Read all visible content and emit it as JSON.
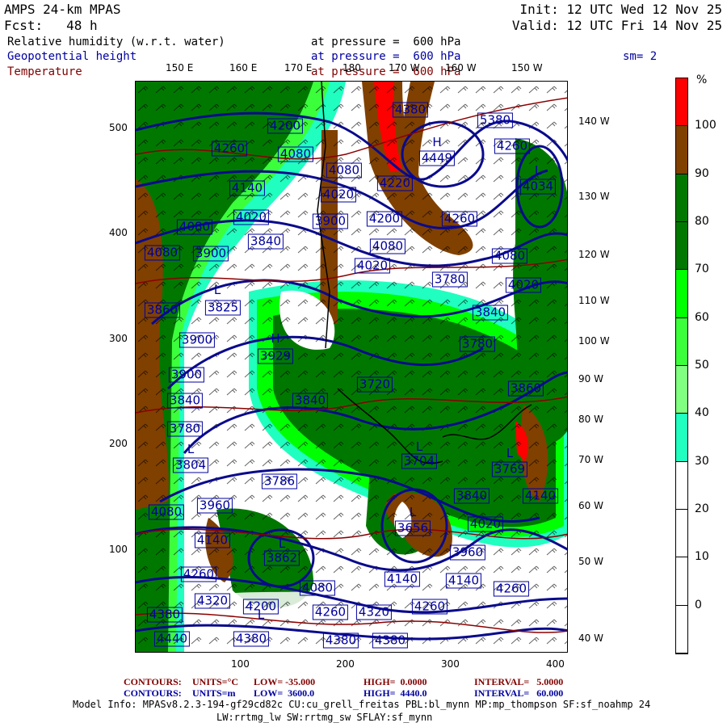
{
  "header": {
    "title": "AMPS 24-km MPAS",
    "forecast": "Fcst:   48 h",
    "init": "Init: 12 UTC Wed 12 Nov 25",
    "valid": "Valid: 12 UTC Fri 14 Nov 25",
    "fields": [
      {
        "name": "Relative humidity (w.r.t. water)",
        "level": "at pressure =  600 hPa"
      },
      {
        "name": "Geopotential height",
        "level": "at pressure =  600 hPa"
      },
      {
        "name": "Temperature",
        "level": "at pressure =  600 hPa"
      }
    ],
    "smoothing": "sm= 2"
  },
  "axes": {
    "top_lon": [
      "150 E",
      "160 E",
      "170 E",
      "180",
      "170 W",
      "160 W",
      "150 W"
    ],
    "right_lon": [
      "140 W",
      "130 W",
      "120 W",
      "110 W",
      "100 W",
      "90 W",
      "80 W",
      "70 W",
      "60 W",
      "50 W",
      "40 W"
    ],
    "left_ticks": [
      "500",
      "400",
      "300",
      "200",
      "100"
    ],
    "bottom_ticks": [
      "100",
      "200",
      "300",
      "400"
    ]
  },
  "colorbar": {
    "unit": "%",
    "labels": [
      "100",
      "90",
      "80",
      "70",
      "60",
      "50",
      "40",
      "30",
      "20",
      "10",
      "0"
    ],
    "colors": [
      "#ff0000",
      "#804000",
      "#007800",
      "#007800",
      "#00ff00",
      "#3cff3c",
      "#80ff80",
      "#20ffc0",
      "#ffffff",
      "#ffffff",
      "#ffffff",
      "#ffffff"
    ]
  },
  "contour_info": {
    "temperature": {
      "label": "CONTOURS:",
      "units": "UNITS=°C",
      "low": "LOW= -35.000",
      "high": "HIGH=  0.0000",
      "interval": "INTERVAL=   5.0000"
    },
    "height": {
      "label": "CONTOURS:",
      "units": "UNITS=m",
      "low": "LOW=  3600.0",
      "high": "HIGH=  4440.0",
      "interval": "INTERVAL=   60.000"
    }
  },
  "model_info": {
    "line1": "Model Info: MPASv8.2.3-194-gf29cd82c CU:cu_grell_freitas PBL:bl_mynn MP:mp_thompson SF:sf_noahmp 24",
    "line2": "LW:rrtmg_lw SW:rrtmg_sw SFLAY:sf_mynn"
  },
  "map": {
    "height_labels": [
      "4380",
      "5380",
      "4449",
      "4260",
      "4200",
      "4260",
      "4080",
      "4080",
      "4020",
      "4140",
      "4220",
      "4034",
      "4020",
      "4200",
      "4260",
      "3900",
      "4080",
      "3840",
      "4080",
      "4080",
      "3900",
      "4080",
      "4020",
      "3780",
      "4020",
      "3860",
      "3840",
      "3825",
      "3900",
      "3929",
      "3780",
      "3900",
      "3840",
      "3840",
      "3780",
      "3804",
      "3786",
      "3720",
      "3860",
      "3704",
      "3769",
      "3840",
      "4140",
      "3960",
      "4080",
      "4020",
      "3656",
      "4140",
      "3862",
      "3960",
      "4260",
      "4080",
      "4140",
      "4140",
      "4260",
      "4320",
      "4200",
      "4260",
      "4320",
      "4260",
      "4380",
      "4440",
      "4380",
      "4380",
      "4380"
    ],
    "pressure_centers": [
      "H",
      "L",
      "L",
      "H",
      "L",
      "L",
      "L",
      "L",
      "L",
      "L"
    ]
  }
}
